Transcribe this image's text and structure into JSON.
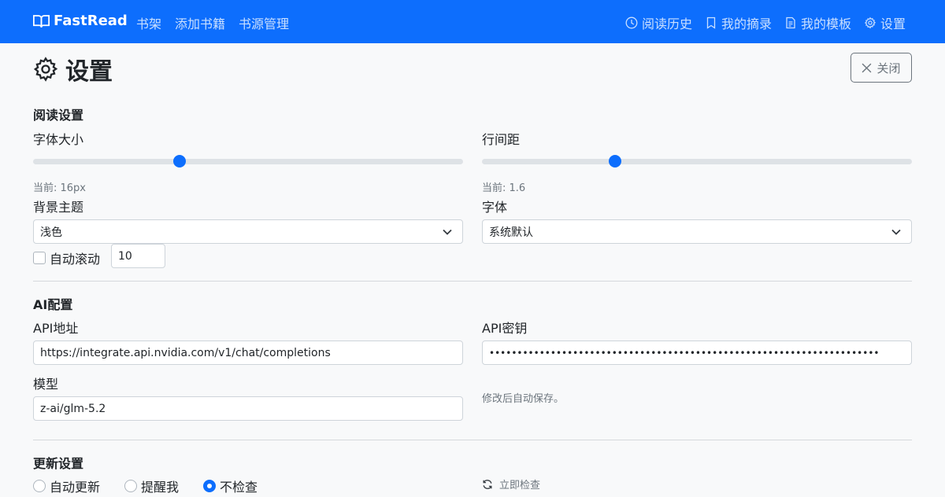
{
  "navbar": {
    "brand": "FastRead",
    "left_links": [
      "书架",
      "添加书籍",
      "书源管理"
    ],
    "right_links": [
      {
        "label": "阅读历史",
        "icon": "clock-icon"
      },
      {
        "label": "我的摘录",
        "icon": "bookmark-icon"
      },
      {
        "label": "我的模板",
        "icon": "document-icon"
      },
      {
        "label": "设置",
        "icon": "gear-icon"
      }
    ],
    "colors": {
      "background": "#0d6efd",
      "text": "#ffffff"
    }
  },
  "header": {
    "title": "设置",
    "close_label": "关闭"
  },
  "reading": {
    "title": "阅读设置",
    "font_size_label": "字体大小",
    "font_size_hint": "当前: 16px",
    "font_size_level": 0.34,
    "line_height_label": "行间距",
    "line_height_hint": "当前: 1.6",
    "line_height_level": 0.31,
    "theme_label": "背景主题",
    "theme_value": "浅色",
    "font_label": "字体",
    "font_value": "系统默认",
    "autoscroll_label": "自动滚动",
    "autoscroll_checked": false,
    "autoscroll_speed": "10"
  },
  "ai": {
    "title": "AI配置",
    "api_url_label": "API地址",
    "api_url_value": "https://integrate.api.nvidia.com/v1/chat/completions",
    "api_key_label": "API密钥",
    "api_key_value": "••••••••••••••••••••••••••••••••••••••••••••••••••••••••••••••••••••••",
    "model_label": "模型",
    "model_value": "z-ai/glm-5.2",
    "autosave_hint": "修改后自动保存。"
  },
  "update": {
    "title": "更新设置",
    "options": [
      {
        "label": "自动更新",
        "selected": false
      },
      {
        "label": "提醒我",
        "selected": false
      },
      {
        "label": "不检查",
        "selected": true
      }
    ],
    "check_now_label": "立即检查"
  },
  "colors": {
    "accent": "#0d6efd",
    "page_bg": "#f8f9fa"
  }
}
